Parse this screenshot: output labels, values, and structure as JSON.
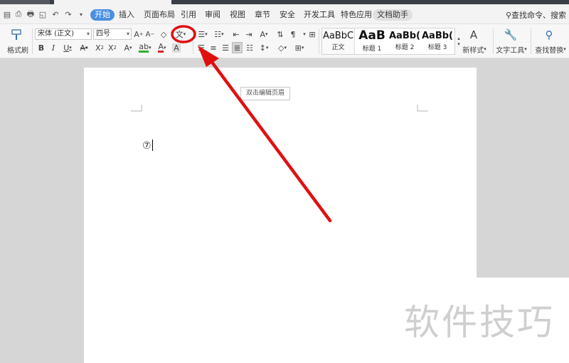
{
  "menubar": {
    "tabs": [
      {
        "label": "开始",
        "name": "menu-tab-home"
      },
      {
        "label": "插入",
        "name": "menu-tab-insert"
      },
      {
        "label": "页面布局",
        "name": "menu-tab-layout"
      },
      {
        "label": "引用",
        "name": "menu-tab-references"
      },
      {
        "label": "审阅",
        "name": "menu-tab-review"
      },
      {
        "label": "视图",
        "name": "menu-tab-view"
      },
      {
        "label": "章节",
        "name": "menu-tab-chapter"
      },
      {
        "label": "安全",
        "name": "menu-tab-security"
      },
      {
        "label": "开发工具",
        "name": "menu-tab-developer"
      },
      {
        "label": "特色应用",
        "name": "menu-tab-features"
      },
      {
        "label": "文档助手",
        "name": "menu-tab-doc-assistant"
      }
    ],
    "search_label": "查找命令、搜索"
  },
  "ribbon": {
    "format_painter_label": "格式刷",
    "font_name": "宋体 (正文)",
    "font_size": "四号",
    "styles": [
      {
        "sample": "AaBbC",
        "label": "正文"
      },
      {
        "sample": "AaB",
        "label": "标题 1"
      },
      {
        "sample": "AaBb(",
        "label": "标题 2"
      },
      {
        "sample": "AaBb(",
        "label": "标题 3"
      }
    ],
    "new_style_label": "新样式",
    "text_tools_label": "文字工具",
    "find_replace_label": "查找替换"
  },
  "document": {
    "header_hint": "双击编辑页眉",
    "body_text": "⑦"
  },
  "watermark": "软件技巧",
  "colors": {
    "accent": "#4a8fe0",
    "arrow_red": "#e01010"
  }
}
